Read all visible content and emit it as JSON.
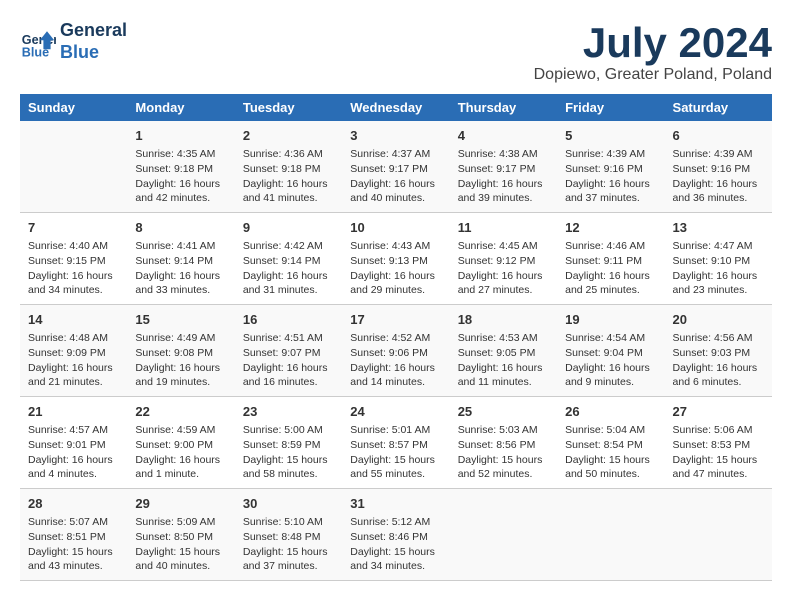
{
  "header": {
    "logo_line1": "General",
    "logo_line2": "Blue",
    "month": "July 2024",
    "location": "Dopiewo, Greater Poland, Poland"
  },
  "weekdays": [
    "Sunday",
    "Monday",
    "Tuesday",
    "Wednesday",
    "Thursday",
    "Friday",
    "Saturday"
  ],
  "weeks": [
    [
      {
        "day": "",
        "info": ""
      },
      {
        "day": "1",
        "info": "Sunrise: 4:35 AM\nSunset: 9:18 PM\nDaylight: 16 hours\nand 42 minutes."
      },
      {
        "day": "2",
        "info": "Sunrise: 4:36 AM\nSunset: 9:18 PM\nDaylight: 16 hours\nand 41 minutes."
      },
      {
        "day": "3",
        "info": "Sunrise: 4:37 AM\nSunset: 9:17 PM\nDaylight: 16 hours\nand 40 minutes."
      },
      {
        "day": "4",
        "info": "Sunrise: 4:38 AM\nSunset: 9:17 PM\nDaylight: 16 hours\nand 39 minutes."
      },
      {
        "day": "5",
        "info": "Sunrise: 4:39 AM\nSunset: 9:16 PM\nDaylight: 16 hours\nand 37 minutes."
      },
      {
        "day": "6",
        "info": "Sunrise: 4:39 AM\nSunset: 9:16 PM\nDaylight: 16 hours\nand 36 minutes."
      }
    ],
    [
      {
        "day": "7",
        "info": "Sunrise: 4:40 AM\nSunset: 9:15 PM\nDaylight: 16 hours\nand 34 minutes."
      },
      {
        "day": "8",
        "info": "Sunrise: 4:41 AM\nSunset: 9:14 PM\nDaylight: 16 hours\nand 33 minutes."
      },
      {
        "day": "9",
        "info": "Sunrise: 4:42 AM\nSunset: 9:14 PM\nDaylight: 16 hours\nand 31 minutes."
      },
      {
        "day": "10",
        "info": "Sunrise: 4:43 AM\nSunset: 9:13 PM\nDaylight: 16 hours\nand 29 minutes."
      },
      {
        "day": "11",
        "info": "Sunrise: 4:45 AM\nSunset: 9:12 PM\nDaylight: 16 hours\nand 27 minutes."
      },
      {
        "day": "12",
        "info": "Sunrise: 4:46 AM\nSunset: 9:11 PM\nDaylight: 16 hours\nand 25 minutes."
      },
      {
        "day": "13",
        "info": "Sunrise: 4:47 AM\nSunset: 9:10 PM\nDaylight: 16 hours\nand 23 minutes."
      }
    ],
    [
      {
        "day": "14",
        "info": "Sunrise: 4:48 AM\nSunset: 9:09 PM\nDaylight: 16 hours\nand 21 minutes."
      },
      {
        "day": "15",
        "info": "Sunrise: 4:49 AM\nSunset: 9:08 PM\nDaylight: 16 hours\nand 19 minutes."
      },
      {
        "day": "16",
        "info": "Sunrise: 4:51 AM\nSunset: 9:07 PM\nDaylight: 16 hours\nand 16 minutes."
      },
      {
        "day": "17",
        "info": "Sunrise: 4:52 AM\nSunset: 9:06 PM\nDaylight: 16 hours\nand 14 minutes."
      },
      {
        "day": "18",
        "info": "Sunrise: 4:53 AM\nSunset: 9:05 PM\nDaylight: 16 hours\nand 11 minutes."
      },
      {
        "day": "19",
        "info": "Sunrise: 4:54 AM\nSunset: 9:04 PM\nDaylight: 16 hours\nand 9 minutes."
      },
      {
        "day": "20",
        "info": "Sunrise: 4:56 AM\nSunset: 9:03 PM\nDaylight: 16 hours\nand 6 minutes."
      }
    ],
    [
      {
        "day": "21",
        "info": "Sunrise: 4:57 AM\nSunset: 9:01 PM\nDaylight: 16 hours\nand 4 minutes."
      },
      {
        "day": "22",
        "info": "Sunrise: 4:59 AM\nSunset: 9:00 PM\nDaylight: 16 hours\nand 1 minute."
      },
      {
        "day": "23",
        "info": "Sunrise: 5:00 AM\nSunset: 8:59 PM\nDaylight: 15 hours\nand 58 minutes."
      },
      {
        "day": "24",
        "info": "Sunrise: 5:01 AM\nSunset: 8:57 PM\nDaylight: 15 hours\nand 55 minutes."
      },
      {
        "day": "25",
        "info": "Sunrise: 5:03 AM\nSunset: 8:56 PM\nDaylight: 15 hours\nand 52 minutes."
      },
      {
        "day": "26",
        "info": "Sunrise: 5:04 AM\nSunset: 8:54 PM\nDaylight: 15 hours\nand 50 minutes."
      },
      {
        "day": "27",
        "info": "Sunrise: 5:06 AM\nSunset: 8:53 PM\nDaylight: 15 hours\nand 47 minutes."
      }
    ],
    [
      {
        "day": "28",
        "info": "Sunrise: 5:07 AM\nSunset: 8:51 PM\nDaylight: 15 hours\nand 43 minutes."
      },
      {
        "day": "29",
        "info": "Sunrise: 5:09 AM\nSunset: 8:50 PM\nDaylight: 15 hours\nand 40 minutes."
      },
      {
        "day": "30",
        "info": "Sunrise: 5:10 AM\nSunset: 8:48 PM\nDaylight: 15 hours\nand 37 minutes."
      },
      {
        "day": "31",
        "info": "Sunrise: 5:12 AM\nSunset: 8:46 PM\nDaylight: 15 hours\nand 34 minutes."
      },
      {
        "day": "",
        "info": ""
      },
      {
        "day": "",
        "info": ""
      },
      {
        "day": "",
        "info": ""
      }
    ]
  ]
}
